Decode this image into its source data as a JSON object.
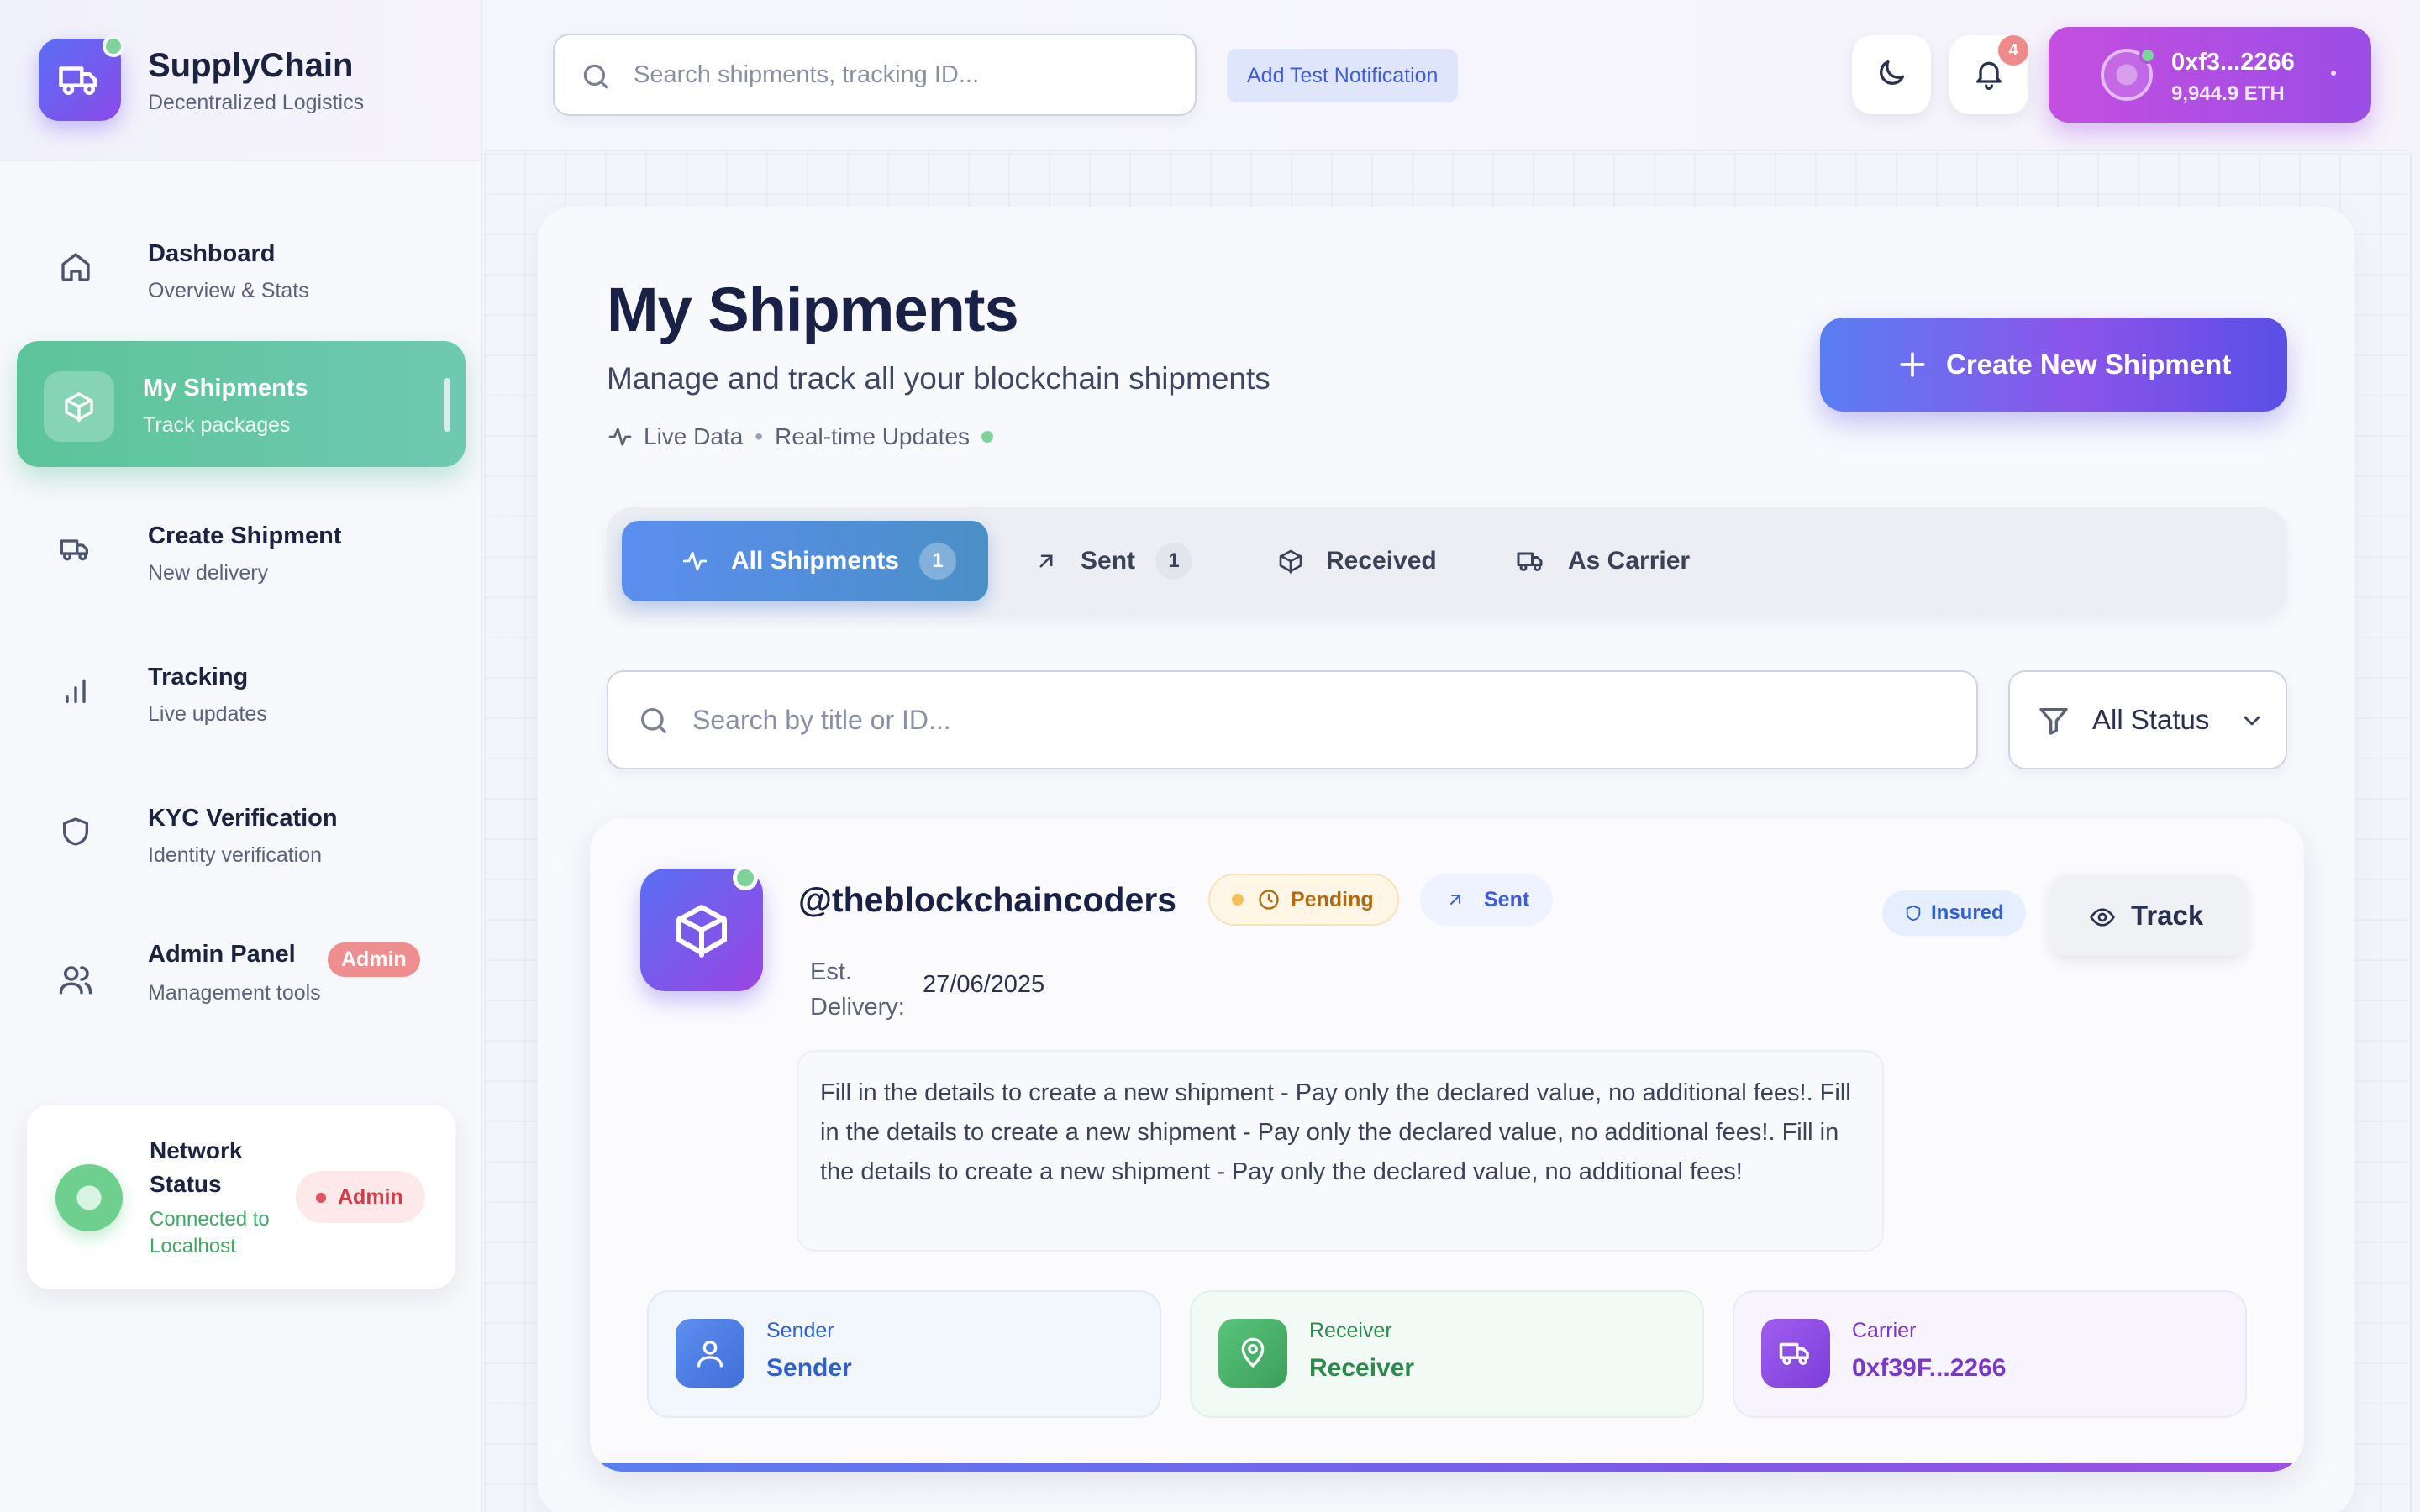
{
  "brand": {
    "title": "SupplyChain",
    "subtitle": "Decentralized Logistics",
    "logo_icon": "truck-icon"
  },
  "sidebar": {
    "items": [
      {
        "title": "Dashboard",
        "subtitle": "Overview & Stats",
        "icon": "home-icon",
        "active": false
      },
      {
        "title": "My Shipments",
        "subtitle": "Track packages",
        "icon": "package-icon",
        "active": true
      },
      {
        "title": "Create Shipment",
        "subtitle": "New delivery",
        "icon": "truck-icon",
        "active": false
      },
      {
        "title": "Tracking",
        "subtitle": "Live updates",
        "icon": "bar-chart-icon",
        "active": false
      },
      {
        "title": "KYC Verification",
        "subtitle": "Identity verification",
        "icon": "shield-icon",
        "active": false
      },
      {
        "title": "Admin Panel",
        "subtitle": "Management tools",
        "icon": "users-icon",
        "active": false,
        "badge": "Admin"
      }
    ],
    "network": {
      "title": "Network Status",
      "status": "Connected to Localhost",
      "badge": "Admin"
    }
  },
  "topbar": {
    "search_placeholder": "Search shipments, tracking ID...",
    "test_button": "Add Test Notification",
    "notification_count": "4",
    "wallet": {
      "address": "0xf3...2266",
      "balance": "9,944.9 ETH"
    }
  },
  "page": {
    "title": "My Shipments",
    "subtitle": "Manage and track all your blockchain shipments",
    "live_label": "Live Data",
    "updates_label": "Real-time Updates",
    "create_button": "Create New Shipment"
  },
  "tabs": [
    {
      "label": "All Shipments",
      "count": "1",
      "active": true,
      "icon": "activity-icon"
    },
    {
      "label": "Sent",
      "count": "1",
      "active": false,
      "icon": "arrow-up-right-icon"
    },
    {
      "label": "Received",
      "active": false,
      "icon": "package-icon"
    },
    {
      "label": "As Carrier",
      "active": false,
      "icon": "truck-icon"
    }
  ],
  "filters": {
    "search_placeholder": "Search by title or ID...",
    "status_selected": "All Status"
  },
  "shipment": {
    "title": "@theblockchaincoders",
    "status": "Pending",
    "direction": "Sent",
    "insured": "Insured",
    "track_button": "Track",
    "est_label": "Est. Delivery:",
    "est_date": "27/06/2025",
    "description": "Fill in the details to create a new shipment - Pay only the declared value, no additional fees!. Fill in the details to create a new shipment - Pay only the declared value, no additional fees!. Fill in the details to create a new shipment - Pay only the declared value, no additional fees!",
    "sender": {
      "label": "Sender",
      "value": "Sender"
    },
    "receiver": {
      "label": "Receiver",
      "value": "Receiver"
    },
    "carrier": {
      "label": "Carrier",
      "value": "0xf39F...2266"
    }
  },
  "colors": {
    "accent_green": "#5cc49a",
    "accent_purple": "#9b4de6",
    "accent_blue": "#5b8ef0"
  }
}
